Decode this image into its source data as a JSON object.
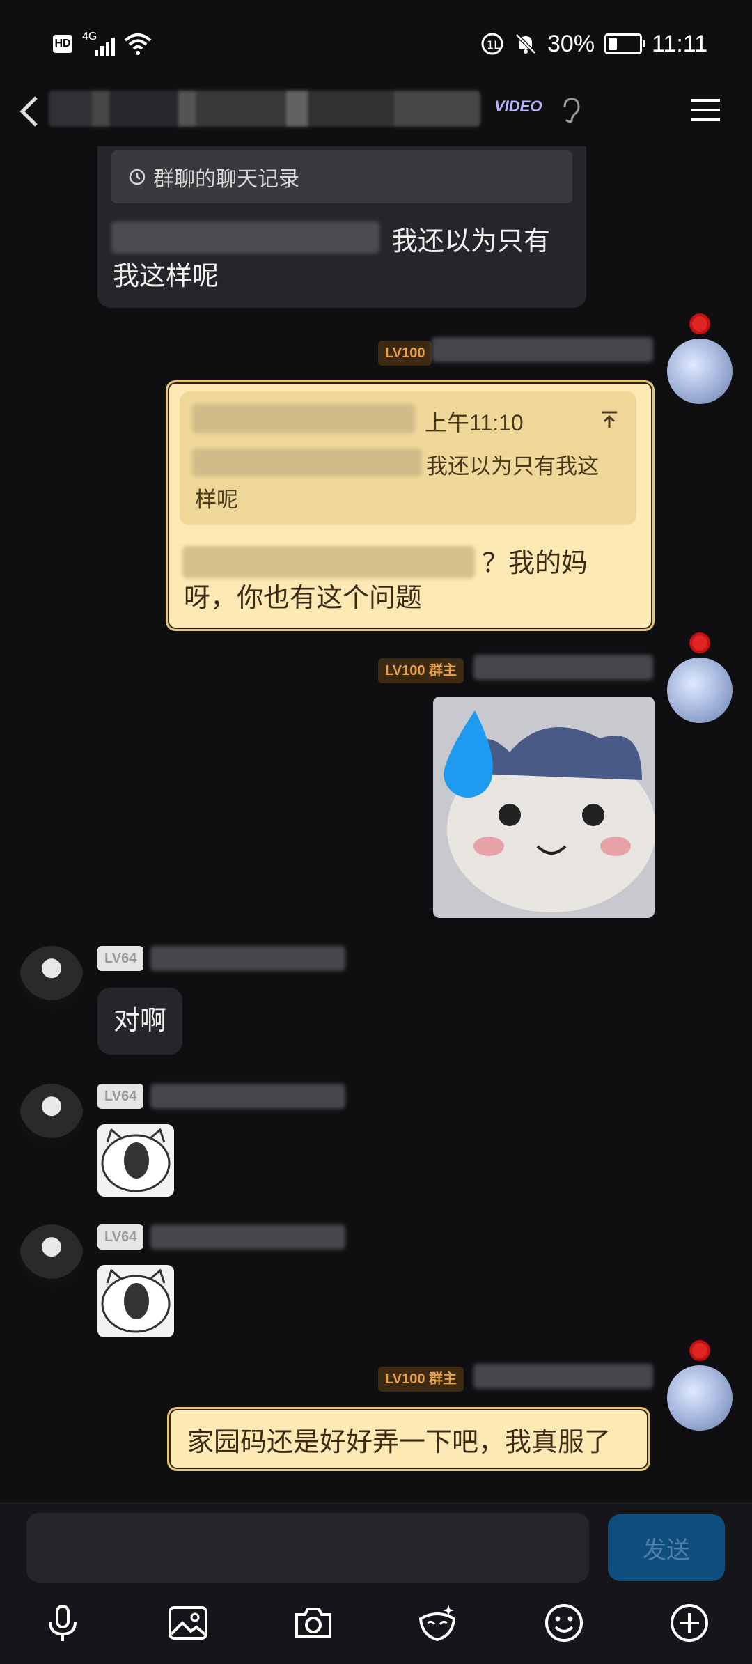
{
  "status_bar": {
    "hd": "HD",
    "network": "4G",
    "battery": "30%",
    "time": "11:11"
  },
  "header": {
    "badge": "VIDEO"
  },
  "messages": {
    "m1": {
      "quote_card": "群聊的聊天记录",
      "text_visible": "我还以为只有我这样呢"
    },
    "m2": {
      "level": "LV100",
      "quote_time": "上午11:10",
      "quote_text": "我还以为只有我这样呢",
      "text_visible": "？我的妈呀，你也有这个问题"
    },
    "m3": {
      "level": "LV100 群主"
    },
    "m4": {
      "level": "LV64",
      "text": "对啊"
    },
    "m5": {
      "level": "LV64"
    },
    "m6": {
      "level": "LV64"
    },
    "m7": {
      "level": "LV100 群主",
      "text": "家园码还是好好弄一下吧，我真服了"
    }
  },
  "input": {
    "send_label": "发送"
  },
  "toolbar_icons": [
    "microphone-icon",
    "image-icon",
    "camera-icon",
    "ai-mask-icon",
    "emoji-icon",
    "plus-icon"
  ]
}
